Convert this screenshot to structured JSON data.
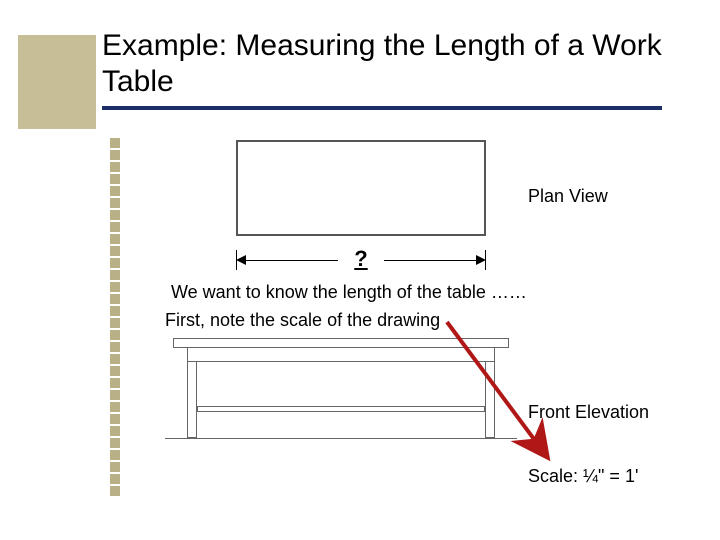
{
  "title": "Example: Measuring the Length of a Work Table",
  "labels": {
    "plan_view": "Plan View",
    "front_elevation": "Front Elevation",
    "scale": "Scale: ¼\" = 1'"
  },
  "dimension": {
    "unknown_symbol": "?"
  },
  "body": {
    "line1": "We want to know the length of the table ……",
    "line2": "First, note the scale of the drawing"
  },
  "icons": {
    "bullet_square": "bullet-square-icon",
    "dimension_arrow": "dimension-arrow-icon",
    "callout_arrow": "callout-arrow-icon"
  },
  "colors": {
    "accent_beige": "#c7bd97",
    "rule_navy": "#1b2f66",
    "callout_red": "#b01818"
  }
}
